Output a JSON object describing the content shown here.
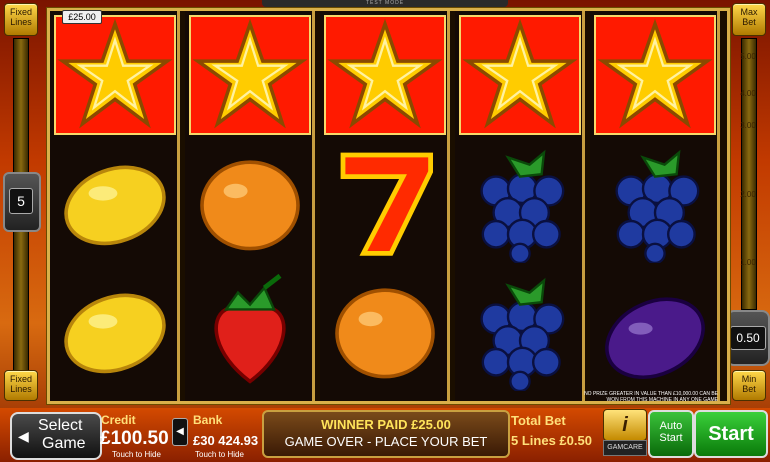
{
  "header": {
    "mode_label": "TEST MODE"
  },
  "left_panel": {
    "fixed_lines_top": [
      "Fixed",
      "Lines"
    ],
    "lines_value": "5",
    "fixed_lines_bottom": [
      "Fixed",
      "Lines"
    ]
  },
  "right_panel": {
    "max_bet": [
      "Max",
      "Bet"
    ],
    "scale": [
      "5.00",
      "4.00",
      "3.00",
      "2.00",
      "1.00"
    ],
    "bet_value": "0.50",
    "min_bet": [
      "Min",
      "Bet"
    ]
  },
  "win_badge": "£25.00",
  "reels": [
    [
      "star",
      "lemon",
      "lemon"
    ],
    [
      "star",
      "orange",
      "strawberry"
    ],
    [
      "star",
      "seven",
      "orange"
    ],
    [
      "star",
      "grapes",
      "grapes"
    ],
    [
      "star",
      "grapes",
      "plum"
    ]
  ],
  "winning_row": 0,
  "notice": "NO PRIZE GREATER IN VALUE THAN £10,000.00 CAN BE WON FROM THIS MACHINE IN ANY ONE GAME",
  "bottom_bar": {
    "select_game": [
      "Select",
      "Game"
    ],
    "credit_label": "Credit",
    "credit_value": "£100.50",
    "credit_hint": "Touch to Hide",
    "bank_label": "Bank",
    "bank_value": "£30 424.93",
    "bank_hint": "Touch to Hide",
    "message_line1": "WINNER PAID £25.00",
    "message_line2": "GAME OVER - PLACE YOUR BET",
    "total_bet_label": "Total Bet",
    "total_bet_value": "5 Lines £0.50",
    "info_label": "i",
    "gamcare_label": "GAMCARE",
    "auto_start": [
      "Auto",
      "Start"
    ],
    "start_label": "Start"
  },
  "colors": {
    "win_red": "#ff1a00",
    "frame_gold": "#d9b04a",
    "start_green": "#1aa01a"
  }
}
